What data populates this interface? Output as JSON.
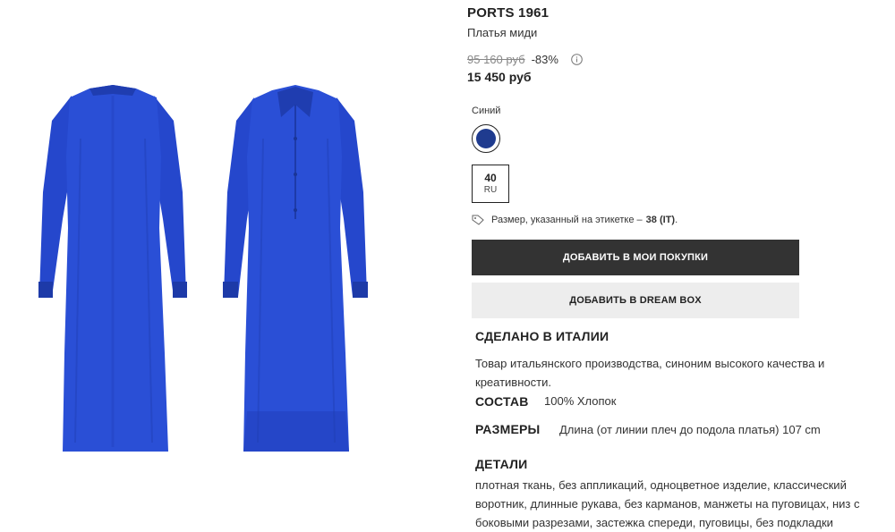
{
  "product": {
    "brand": "PORTS 1961",
    "category": "Платья миди",
    "old_price": "95 160 руб",
    "discount": "-83%",
    "price": "15 450 руб"
  },
  "color": {
    "label": "Синий",
    "swatch_hex": "#1f3b8f"
  },
  "size": {
    "value": "40",
    "system": "RU",
    "note_prefix": "Размер, указанный на этикетке –",
    "note_value": "38 (IT)",
    "note_suffix": "."
  },
  "actions": {
    "add_to_cart": "ДОБАВИТЬ В МОИ ПОКУПКИ",
    "add_to_dreambox": "ДОБАВИТЬ В DREAM BOX"
  },
  "made_in": {
    "title": "СДЕЛАНО В ИТАЛИИ",
    "text": "Товар итальянского производства, синоним высокого качества и креативности."
  },
  "composition": {
    "title": "СОСТАВ",
    "value": "100% Хлопок"
  },
  "sizes": {
    "title": "РАЗМЕРЫ",
    "value": "Длина (от линии плеч до подола платья) 107 cm"
  },
  "details": {
    "title": "ДЕТАЛИ",
    "text": "плотная ткань, без аппликаций, одноцветное изделие, классический воротник, длинные рукава, без карманов, манжеты на пуговицах, низ с боковыми разрезами, застежка спереди, пуговицы, без подкладки"
  },
  "icons": {
    "info": "info-icon",
    "tag": "tag-icon"
  },
  "colors": {
    "dress_blue": "#2a4fd6",
    "button_dark": "#333333",
    "button_light": "#ededed"
  }
}
